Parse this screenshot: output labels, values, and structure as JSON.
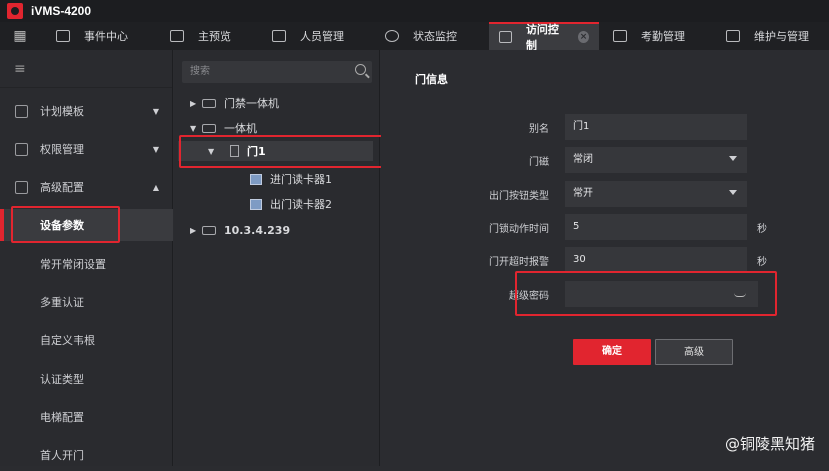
{
  "app": {
    "title": "iVMS-4200"
  },
  "menu": {
    "tabs": [
      {
        "label": "事件中心",
        "icon": "bell-icon"
      },
      {
        "label": "主预览",
        "icon": "camera-icon"
      },
      {
        "label": "人员管理",
        "icon": "person-icon"
      },
      {
        "label": "状态监控",
        "icon": "monitor-icon"
      },
      {
        "label": "访问控制",
        "icon": "door-icon",
        "active": true
      },
      {
        "label": "考勤管理",
        "icon": "calendar-icon"
      },
      {
        "label": "维护与管理",
        "icon": "tools-icon"
      }
    ]
  },
  "sidebar": {
    "groups": [
      {
        "label": "计划模板"
      },
      {
        "label": "权限管理"
      },
      {
        "label": "高级配置"
      }
    ],
    "items": [
      {
        "label": "设备参数",
        "active": true
      },
      {
        "label": "常开常闭设置"
      },
      {
        "label": "多重认证"
      },
      {
        "label": "自定义韦根"
      },
      {
        "label": "认证类型"
      },
      {
        "label": "电梯配置"
      },
      {
        "label": "首人开门"
      }
    ]
  },
  "tree": {
    "search_placeholder": "搜索",
    "nodes": [
      {
        "label": "门禁一体机"
      },
      {
        "label": "一体机"
      },
      {
        "label": "门1"
      },
      {
        "label": "进门读卡器1"
      },
      {
        "label": "出门读卡器2"
      },
      {
        "label": "10.3.4.239"
      }
    ]
  },
  "form": {
    "section_title": "门信息",
    "fields": [
      {
        "label": "别名",
        "value": "门1"
      },
      {
        "label": "门磁",
        "value": "常闭"
      },
      {
        "label": "出门按钮类型",
        "value": "常开"
      },
      {
        "label": "门锁动作时间",
        "value": "5",
        "unit": "秒"
      },
      {
        "label": "门开超时报警",
        "value": "30",
        "unit": "秒"
      },
      {
        "label": "超级密码",
        "value": ""
      }
    ],
    "ok_label": "确定",
    "advanced_label": "高级"
  },
  "watermark": "@铜陵黑知猪",
  "colors": {
    "accent": "#e1252f",
    "background": "#2b2c30"
  }
}
